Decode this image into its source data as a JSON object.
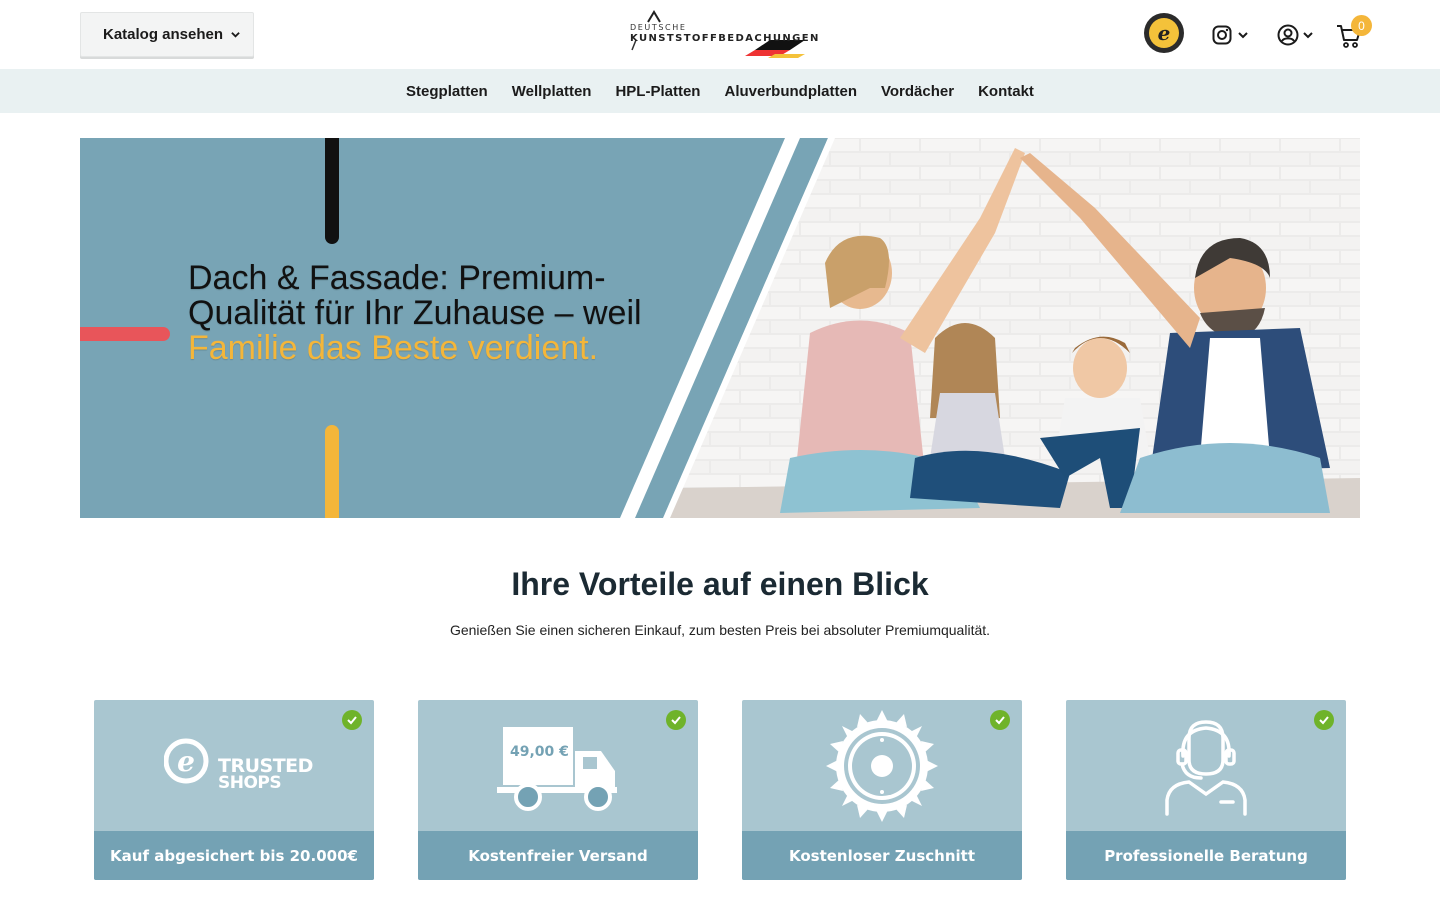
{
  "header": {
    "catalog_button": "Katalog ansehen",
    "logo_line1": "DEUTSCHE",
    "logo_line2": "KUNSTSTOFFBEDACHUNGEN",
    "cart_count": "0"
  },
  "nav": {
    "items": [
      "Stegplatten",
      "Wellplatten",
      "HPL-Platten",
      "Aluverbundplatten",
      "Vordächer",
      "Kontakt"
    ]
  },
  "hero": {
    "headline_part1": "Dach & Fassade: Premium-Qualität für Ihr Zuhause – weil ",
    "headline_highlight": "Familie das Beste verdient.",
    "bg_color": "#78a4b5",
    "highlight_color": "#f4b63a"
  },
  "advantages": {
    "title": "Ihre Vorteile auf einen Blick",
    "subtitle": "Genießen Sie einen sicheren Einkauf, zum besten Preis bei absoluter Premiumqualität.",
    "cards": [
      {
        "label": "Kauf abgesichert bis 20.000€",
        "icon": "trusted-shops-logo",
        "logo_text1": "TRUSTED",
        "logo_text2": "SHOPS"
      },
      {
        "label": "Kostenfreier Versand",
        "icon": "delivery-truck-icon",
        "truck_text": "49,00 €"
      },
      {
        "label": "Kostenloser Zuschnitt",
        "icon": "saw-blade-icon"
      },
      {
        "label": "Professionelle Beratung",
        "icon": "support-agent-icon"
      }
    ]
  },
  "colors": {
    "nav_bg": "#e9f1f2",
    "card_bg": "#a9c6d0",
    "card_footer": "#74a2b4",
    "check_green": "#6fb32a"
  }
}
